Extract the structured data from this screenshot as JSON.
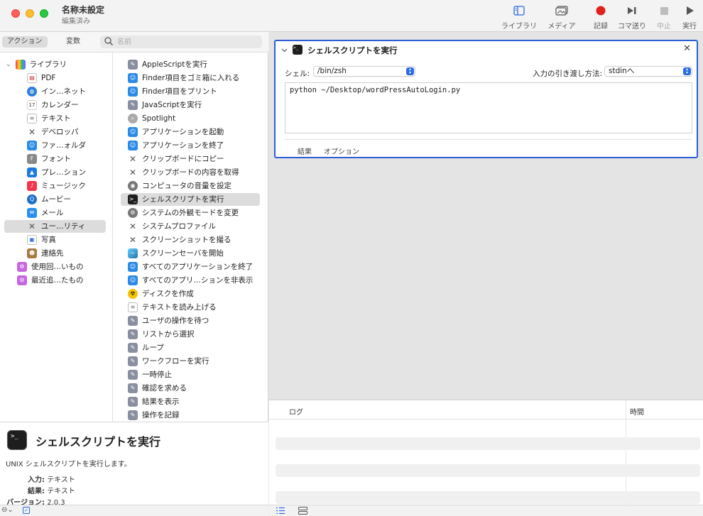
{
  "window": {
    "title": "名称未設定",
    "subtitle": "編集済み"
  },
  "toolbar": {
    "library": "ライブラリ",
    "media": "メディア",
    "record": "記録",
    "step": "コマ送り",
    "stop": "中止",
    "run": "実行",
    "icons": [
      "sidebar-icon",
      "media-icon",
      "record-icon",
      "step-icon",
      "stop-icon",
      "play-icon"
    ],
    "record_color": "#e0211c"
  },
  "segments": {
    "actions": "アクション",
    "variables": "変数"
  },
  "search": {
    "placeholder": "名前"
  },
  "categories": [
    "ライブラリ",
    "PDF",
    "イン…ネット",
    "カレンダー",
    "テキスト",
    "デベロッパ",
    "ファ…ォルダ",
    "フォント",
    "プレ…ション",
    "ミュージック",
    "ムービー",
    "メール",
    "ユー…リティ",
    "写真",
    "連絡先",
    "使用回…いもの",
    "最近追…たもの"
  ],
  "actions": [
    "AppleScriptを実行",
    "Finder項目をゴミ箱に入れる",
    "Finder項目をプリント",
    "JavaScriptを実行",
    "Spotlight",
    "アプリケーションを起動",
    "アプリケーションを終了",
    "クリップボードにコピー",
    "クリップボードの内容を取得",
    "コンピュータの音量を設定",
    "シェルスクリプトを実行",
    "システムの外観モードを変更",
    "システムプロファイル",
    "スクリーンショットを撮る",
    "スクリーンセーバを開始",
    "すべてのアプリケーションを終了",
    "すべてのアプリ…ションを非表示",
    "ディスクを作成",
    "テキストを読み上げる",
    "ユーザの操作を待つ",
    "リストから選択",
    "ループ",
    "ワークフローを実行",
    "一時停止",
    "確認を求める",
    "結果を表示",
    "操作を記録"
  ],
  "info": {
    "title": "シェルスクリプトを実行",
    "description": "UNIX シェルスクリプトを実行します。",
    "input_label": "入力:",
    "input_value": "テキスト",
    "result_label": "結果:",
    "result_value": "テキスト",
    "version_label": "バージョン:",
    "version_value": "2.0.3"
  },
  "card": {
    "title": "シェルスクリプトを実行",
    "shell_label": "シェル:",
    "shell_value": "/bin/zsh",
    "pass_input_label": "入力の引き渡し方法:",
    "pass_input_value": "stdinへ",
    "script": "python ~/Desktop/wordPressAutoLogin.py",
    "tab_results": "結果",
    "tab_options": "オプション",
    "close_glyph": "✕"
  },
  "log": {
    "col_log": "ログ",
    "col_time": "時間"
  },
  "accent": "#2a5fd3"
}
